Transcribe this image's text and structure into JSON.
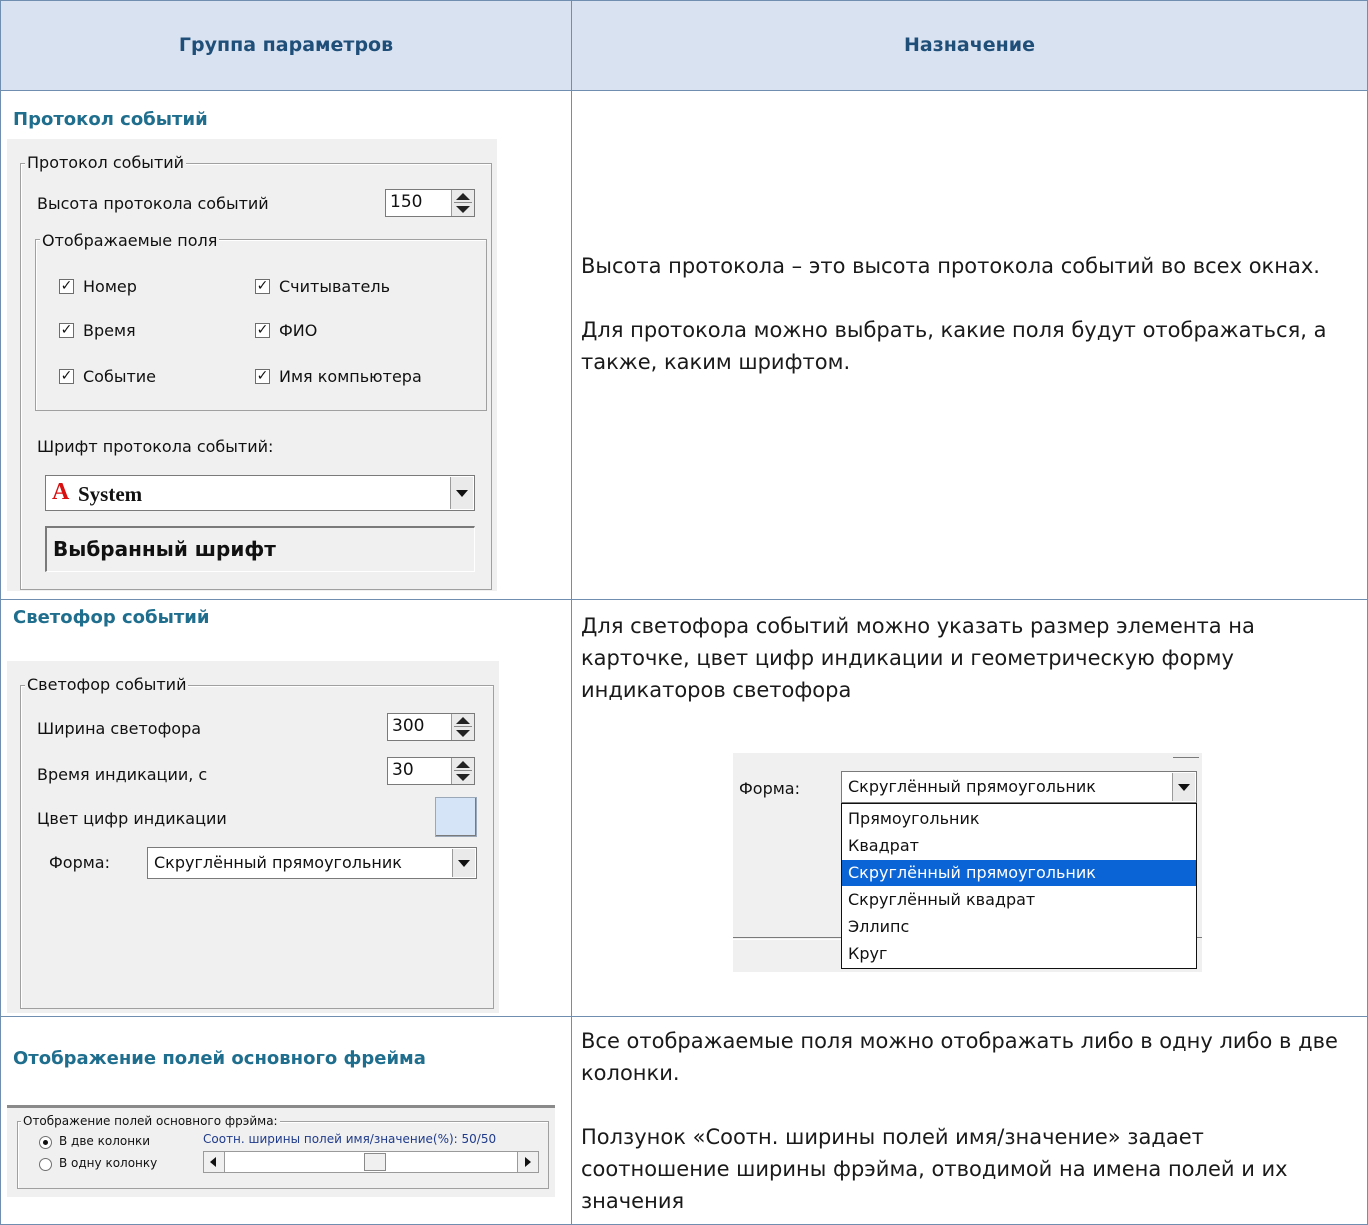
{
  "header": {
    "col1": "Группа параметров",
    "col2": "Назначение"
  },
  "rows": [
    {
      "title": "Протокол событий",
      "panel": {
        "group_title": "Протокол событий",
        "height_label": "Высота протокола событий",
        "height_value": "150",
        "fields_title": "Отображаемые поля",
        "fields": [
          {
            "label": "Номер",
            "checked": true
          },
          {
            "label": "Считыватель",
            "checked": true
          },
          {
            "label": "Время",
            "checked": true
          },
          {
            "label": "ФИО",
            "checked": true
          },
          {
            "label": "Событие",
            "checked": true
          },
          {
            "label": "Имя компьютера",
            "checked": true
          }
        ],
        "font_label": "Шрифт протокола событий:",
        "font_value": "System",
        "font_icon": "font-a-icon",
        "preview_text": "Выбранный шрифт"
      },
      "desc": [
        "Высота протокола – это высота протокола событий во всех окнах.",
        "Для протокола можно выбрать, какие поля будут отображаться, а также, каким шрифтом."
      ]
    },
    {
      "title": "Светофор событий",
      "panel": {
        "group_title": "Светофор событий",
        "width_label": "Ширина светофора",
        "width_value": "300",
        "time_label": "Время индикации, с",
        "time_value": "30",
        "color_label": "Цвет цифр индикации",
        "color_value": "#d6e4f7",
        "shape_label": "Форма:",
        "shape_value": "Скруглённый прямоугольник"
      },
      "desc": [
        "Для светофора событий можно указать размер элемента на карточке, цвет цифр индикации и геометрическую форму индикаторов светофора"
      ],
      "dropdown": {
        "label": "Форма:",
        "value": "Скруглённый прямоугольник",
        "options": [
          "Прямоугольник",
          "Квадрат",
          "Скруглённый прямоугольник",
          "Скруглённый квадрат",
          "Эллипс",
          "Круг"
        ],
        "selected_index": 2
      }
    },
    {
      "title": "Отображение полей основного фрейма",
      "panel": {
        "group_title": "Отображение полей основного фрэйма:",
        "radio_two": "В две колонки",
        "radio_one": "В одну колонку",
        "selected": "two",
        "ratio_label": "Соотн. ширины полей имя/значение(%): 50/50",
        "slider_value_percent": 50
      },
      "desc": [
        "Все отображаемые поля можно отображать либо в одну либо в две колонки.",
        "Ползунок «Соотн. ширины полей имя/значение» задает соотношение ширины фрэйма, отводимой на имена полей и их значения"
      ]
    }
  ],
  "colors": {
    "header_bg": "#d9e2f0",
    "header_text": "#1f4e79",
    "title_text": "#1f6e8e",
    "border": "#6f8eb0",
    "selection": "#0a64d6"
  }
}
